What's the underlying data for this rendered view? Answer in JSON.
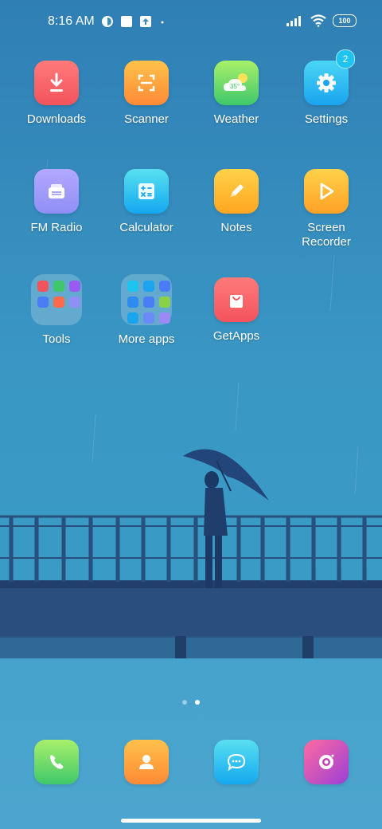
{
  "status_bar": {
    "time": "8:16 AM",
    "battery": "100",
    "icons": [
      "vpn-icon",
      "square-icon",
      "upload-icon",
      "dot-icon",
      "signal-icon",
      "wifi-icon",
      "battery-icon"
    ]
  },
  "apps": [
    {
      "label": "Downloads",
      "icon": "download-icon",
      "color": "#f2545b"
    },
    {
      "label": "Scanner",
      "icon": "scan-icon",
      "color": "#ff8a36"
    },
    {
      "label": "Weather",
      "icon": "weather-icon",
      "color": "#3fc86a",
      "temp": "35°"
    },
    {
      "label": "Settings",
      "icon": "gear-icon",
      "color": "#1aa4f0",
      "badge": "2"
    },
    {
      "label": "FM Radio",
      "icon": "radio-icon",
      "color": "#8f8ff5"
    },
    {
      "label": "Calculator",
      "icon": "calculator-icon",
      "color": "#14a8f0"
    },
    {
      "label": "Notes",
      "icon": "pencil-icon",
      "color": "#ffa61f"
    },
    {
      "label": "Screen\nRecorder",
      "icon": "play-icon",
      "color": "#ffa126"
    },
    {
      "label": "Tools",
      "icon": "folder-icon"
    },
    {
      "label": "More apps",
      "icon": "folder-icon"
    },
    {
      "label": "GetApps",
      "icon": "shopping-bag-icon",
      "color": "#f2545b"
    }
  ],
  "dock": [
    {
      "icon": "phone-icon",
      "color": "#3fc86a"
    },
    {
      "icon": "contacts-icon",
      "color": "#ff8a36"
    },
    {
      "icon": "messages-icon",
      "color": "#14a8f0"
    },
    {
      "icon": "camera-icon",
      "color": "#c63fb3"
    }
  ],
  "page_indicator": {
    "pages": 2,
    "current": 2
  }
}
